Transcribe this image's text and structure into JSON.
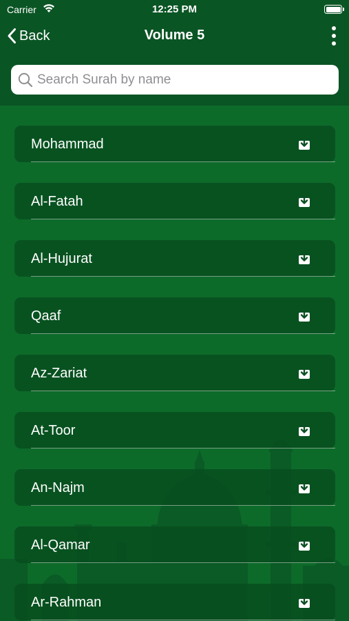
{
  "status_bar": {
    "carrier": "Carrier",
    "time": "12:25 PM"
  },
  "nav": {
    "back_label": "Back",
    "title": "Volume 5"
  },
  "search": {
    "placeholder": "Search Surah by name",
    "value": ""
  },
  "surahs": [
    {
      "name": "Mohammad",
      "icon": "download-icon"
    },
    {
      "name": "Al-Fatah",
      "icon": "download-icon"
    },
    {
      "name": "Al-Hujurat",
      "icon": "download-icon"
    },
    {
      "name": "Qaaf",
      "icon": "download-icon"
    },
    {
      "name": "Az-Zariat",
      "icon": "download-icon"
    },
    {
      "name": "At-Toor",
      "icon": "download-icon"
    },
    {
      "name": "An-Najm",
      "icon": "download-icon"
    },
    {
      "name": "Al-Qamar",
      "icon": "download-icon"
    },
    {
      "name": "Ar-Rahman",
      "icon": "download-icon"
    }
  ],
  "colors": {
    "background": "#0d6b2a",
    "header": "#0a5524",
    "row": "#0b4f22"
  }
}
